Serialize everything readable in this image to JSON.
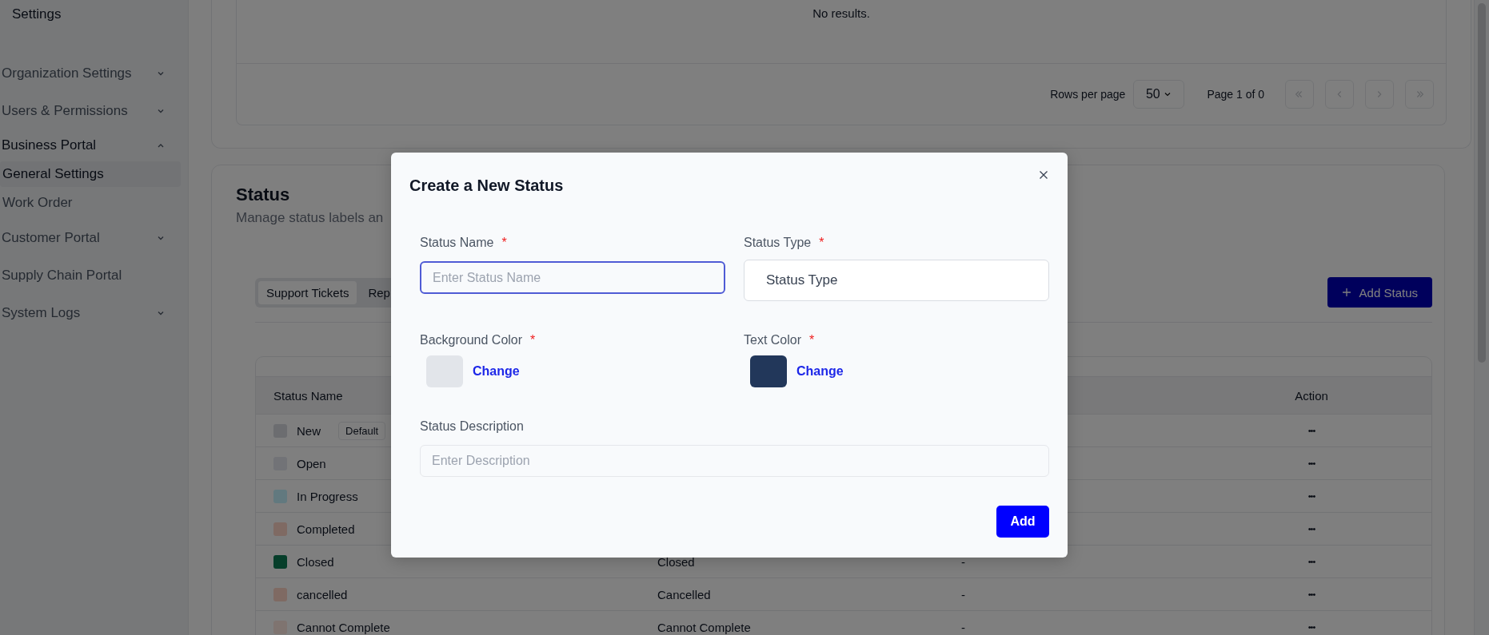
{
  "sidebar": {
    "title": "Settings",
    "items": [
      {
        "kind": "group",
        "label": "Organization Settings",
        "expanded": false
      },
      {
        "kind": "group",
        "label": "Users & Permissions",
        "expanded": false
      },
      {
        "kind": "group",
        "label": "Business Portal",
        "expanded": true,
        "children": [
          {
            "label": "General Settings",
            "selected": true
          },
          {
            "label": "Work Order",
            "selected": false
          }
        ]
      },
      {
        "kind": "group",
        "label": "Customer Portal",
        "expanded": false
      },
      {
        "kind": "link",
        "label": "Supply Chain Portal"
      },
      {
        "kind": "group",
        "label": "System Logs",
        "expanded": false
      }
    ]
  },
  "results_panel": {
    "empty_text": "No results.",
    "rows_per_page_label": "Rows per page",
    "rows_per_page": "50",
    "page_info": "Page 1 of 0",
    "pager_buttons": [
      {
        "kind": "first",
        "disabled": true
      },
      {
        "kind": "prev",
        "disabled": true
      },
      {
        "kind": "next",
        "disabled": true
      },
      {
        "kind": "last",
        "disabled": true
      }
    ]
  },
  "status_section": {
    "title": "Status",
    "subtitle": "Manage status labels an",
    "tabs": [
      {
        "label": "Support Tickets",
        "selected": true
      },
      {
        "label": "Rep",
        "selected": false
      }
    ],
    "add_button": "Add Status",
    "table": {
      "columns": [
        {
          "kind": "name",
          "label": "Status Name"
        },
        {
          "kind": "action",
          "label": "Action"
        }
      ],
      "rows": [
        {
          "name": "New",
          "color": "#6c6d70",
          "badge": "Default",
          "action": "•••"
        },
        {
          "name": "Open",
          "color": "#727377",
          "action": "•••"
        },
        {
          "name": "In Progress",
          "color": "#62798a",
          "action": "•••"
        },
        {
          "name": "Completed",
          "color": "#8a6a63",
          "action": "•••"
        },
        {
          "name": "Closed",
          "color": "#063e2a",
          "type": "Closed",
          "description": "-",
          "action": "•••"
        },
        {
          "name": "cancelled",
          "color": "#8a6a63",
          "type": "Cancelled",
          "description": "-",
          "action": "•••"
        },
        {
          "name": "Cannot Complete",
          "color": "#8a7470",
          "type": "Cannot Complete",
          "description": "-",
          "action": "•••"
        }
      ]
    }
  },
  "dialog": {
    "title": "Create a New Status",
    "fields": [
      {
        "kind": "text",
        "label": "Status Name",
        "required_mark": "*",
        "placeholder": "Enter Status Name",
        "focused": true
      },
      {
        "kind": "select",
        "label": "Status Type",
        "required_mark": "*",
        "value": "Status Type"
      },
      {
        "kind": "color",
        "label": "Background Color",
        "required_mark": "*",
        "color": "#e2e5ea",
        "link": "Change"
      },
      {
        "kind": "color",
        "label": "Text Color",
        "required_mark": "*",
        "color": "#22375a",
        "link": "Change"
      },
      {
        "kind": "description",
        "label": "Status Description",
        "placeholder": "Enter Description",
        "focused": false
      }
    ],
    "submit": "Add"
  }
}
